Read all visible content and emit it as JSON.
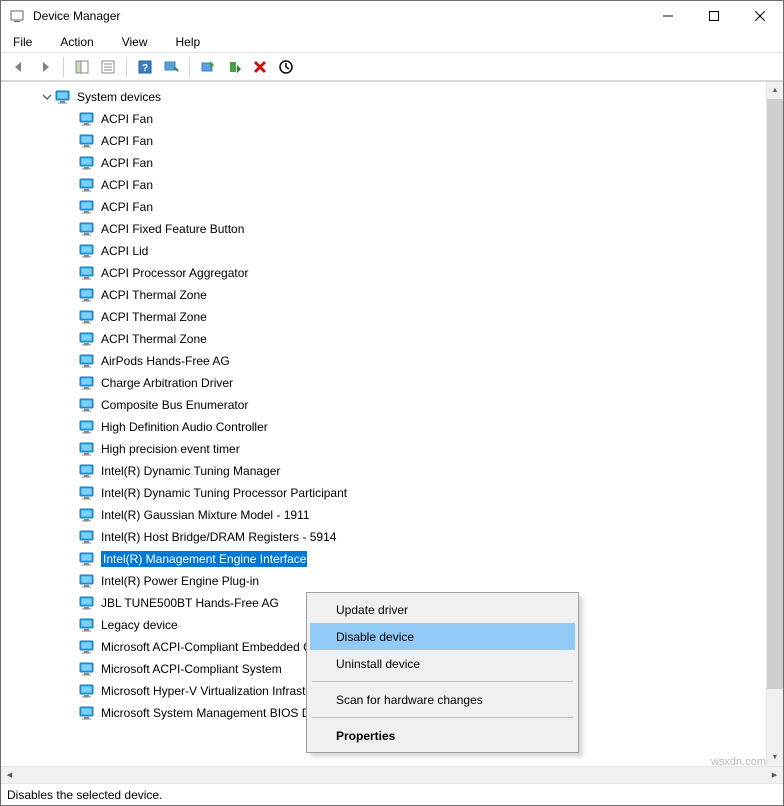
{
  "window": {
    "title": "Device Manager"
  },
  "menus": {
    "file": "File",
    "action": "Action",
    "view": "View",
    "help": "Help"
  },
  "tree": {
    "root": "System devices",
    "items": [
      "ACPI Fan",
      "ACPI Fan",
      "ACPI Fan",
      "ACPI Fan",
      "ACPI Fan",
      "ACPI Fixed Feature Button",
      "ACPI Lid",
      "ACPI Processor Aggregator",
      "ACPI Thermal Zone",
      "ACPI Thermal Zone",
      "ACPI Thermal Zone",
      "AirPods Hands-Free AG",
      "Charge Arbitration Driver",
      "Composite Bus Enumerator",
      "High Definition Audio Controller",
      "High precision event timer",
      "Intel(R) Dynamic Tuning Manager",
      "Intel(R) Dynamic Tuning Processor Participant",
      "Intel(R) Gaussian Mixture Model - 1911",
      "Intel(R) Host Bridge/DRAM Registers - 5914",
      "Intel(R) Management Engine Interface",
      "Intel(R) Power Engine Plug-in",
      "JBL TUNE500BT Hands-Free AG",
      "Legacy device",
      "Microsoft ACPI-Compliant Embedded Controller",
      "Microsoft ACPI-Compliant System",
      "Microsoft Hyper-V Virtualization Infrastructure Driver",
      "Microsoft System Management BIOS Driver"
    ],
    "selected_index": 20
  },
  "context_menu": {
    "update": "Update driver",
    "disable": "Disable device",
    "uninstall": "Uninstall device",
    "scan": "Scan for hardware changes",
    "properties": "Properties",
    "highlighted": "disable"
  },
  "statusbar": {
    "text": "Disables the selected device."
  },
  "watermark": "wsxdn.com"
}
